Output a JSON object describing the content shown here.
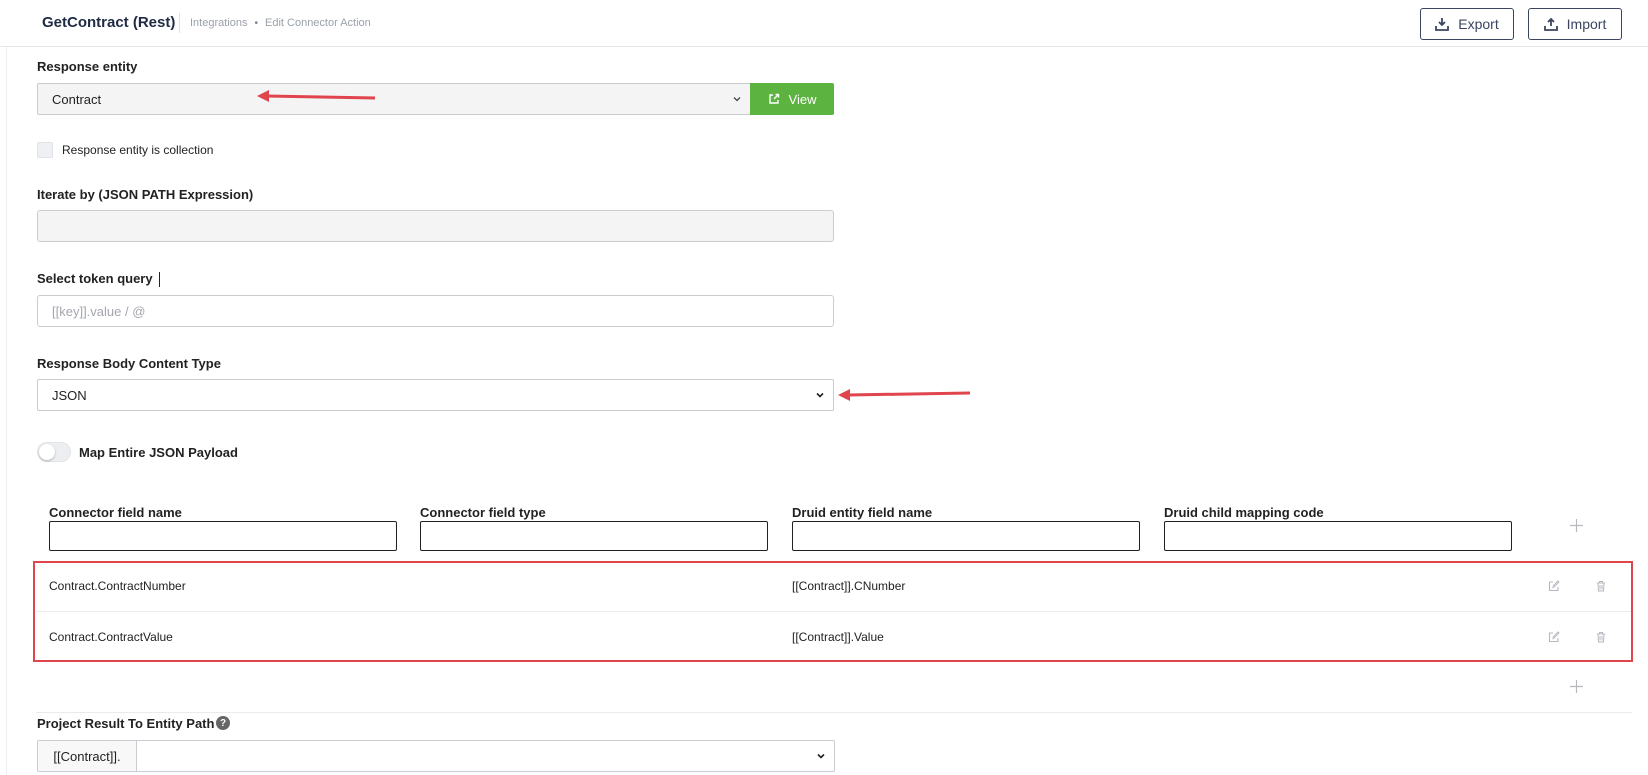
{
  "header": {
    "app_title": "GetContract (Rest)",
    "breadcrumb": [
      "Integrations",
      "Edit Connector Action"
    ],
    "breadcrumb_separator": "•",
    "export_label": "Export",
    "import_label": "Import"
  },
  "response_entity": {
    "label": "Response entity",
    "selected": "Contract",
    "view_label": "View"
  },
  "collection_checkbox": {
    "label": "Response entity is collection",
    "checked": false
  },
  "iterate_by": {
    "label": "Iterate by (JSON PATH Expression)",
    "value": ""
  },
  "token_query": {
    "label": "Select token query",
    "placeholder": "[[key]].value / @"
  },
  "content_type": {
    "label": "Response Body Content Type",
    "selected": "JSON"
  },
  "map_payload_toggle": {
    "label": "Map Entire JSON Payload",
    "on": false
  },
  "mapping_table": {
    "columns": [
      "Connector field name",
      "Connector field type",
      "Druid entity field name",
      "Druid child mapping code"
    ],
    "rows": [
      {
        "connector_field_name": "Contract.ContractNumber",
        "connector_field_type": "",
        "druid_field_name": "[[Contract]].CNumber",
        "child_mapping_code": ""
      },
      {
        "connector_field_name": "Contract.ContractValue",
        "connector_field_type": "",
        "druid_field_name": "[[Contract]].Value",
        "child_mapping_code": ""
      }
    ]
  },
  "project_result": {
    "label": "Project Result To Entity Path",
    "help": "?",
    "prefix": "[[Contract]].",
    "selected": ""
  },
  "colors": {
    "primary_dark": "#3b4560",
    "view_green": "#5cb33f",
    "annotation_red": "#e0444c"
  }
}
